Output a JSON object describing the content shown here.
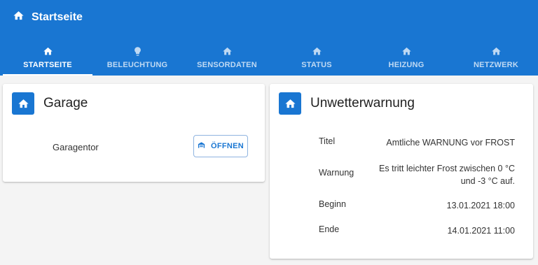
{
  "app": {
    "title": "Startseite",
    "icon": "home-icon"
  },
  "tabs": [
    {
      "label": "STARTSEITE",
      "icon": "home-icon",
      "active": true
    },
    {
      "label": "BELEUCHTUNG",
      "icon": "lightbulb-icon",
      "active": false
    },
    {
      "label": "SENSORDATEN",
      "icon": "home-icon",
      "active": false
    },
    {
      "label": "STATUS",
      "icon": "home-icon",
      "active": false
    },
    {
      "label": "HEIZUNG",
      "icon": "home-icon",
      "active": false
    },
    {
      "label": "NETZWERK",
      "icon": "home-icon",
      "active": false
    }
  ],
  "garage": {
    "title": "Garage",
    "icon": "home-icon",
    "item_label": "Garagentor",
    "button_label": "ÖFFNEN",
    "button_icon": "garage-icon"
  },
  "warning": {
    "title": "Unwetterwarnung",
    "icon": "home-icon",
    "rows": [
      {
        "key": "Titel",
        "value": "Amtliche WARNUNG vor FROST"
      },
      {
        "key": "Warnung",
        "value_line1": "Es tritt leichter Frost zwischen 0 °C",
        "value_line2": "und -3 °C auf."
      },
      {
        "key": "Beginn",
        "value": "13.01.2021 18:00"
      },
      {
        "key": "Ende",
        "value": "14.01.2021 11:00"
      }
    ]
  },
  "colors": {
    "primary": "#1976d2",
    "background": "#f4f4f4",
    "card": "#ffffff"
  }
}
